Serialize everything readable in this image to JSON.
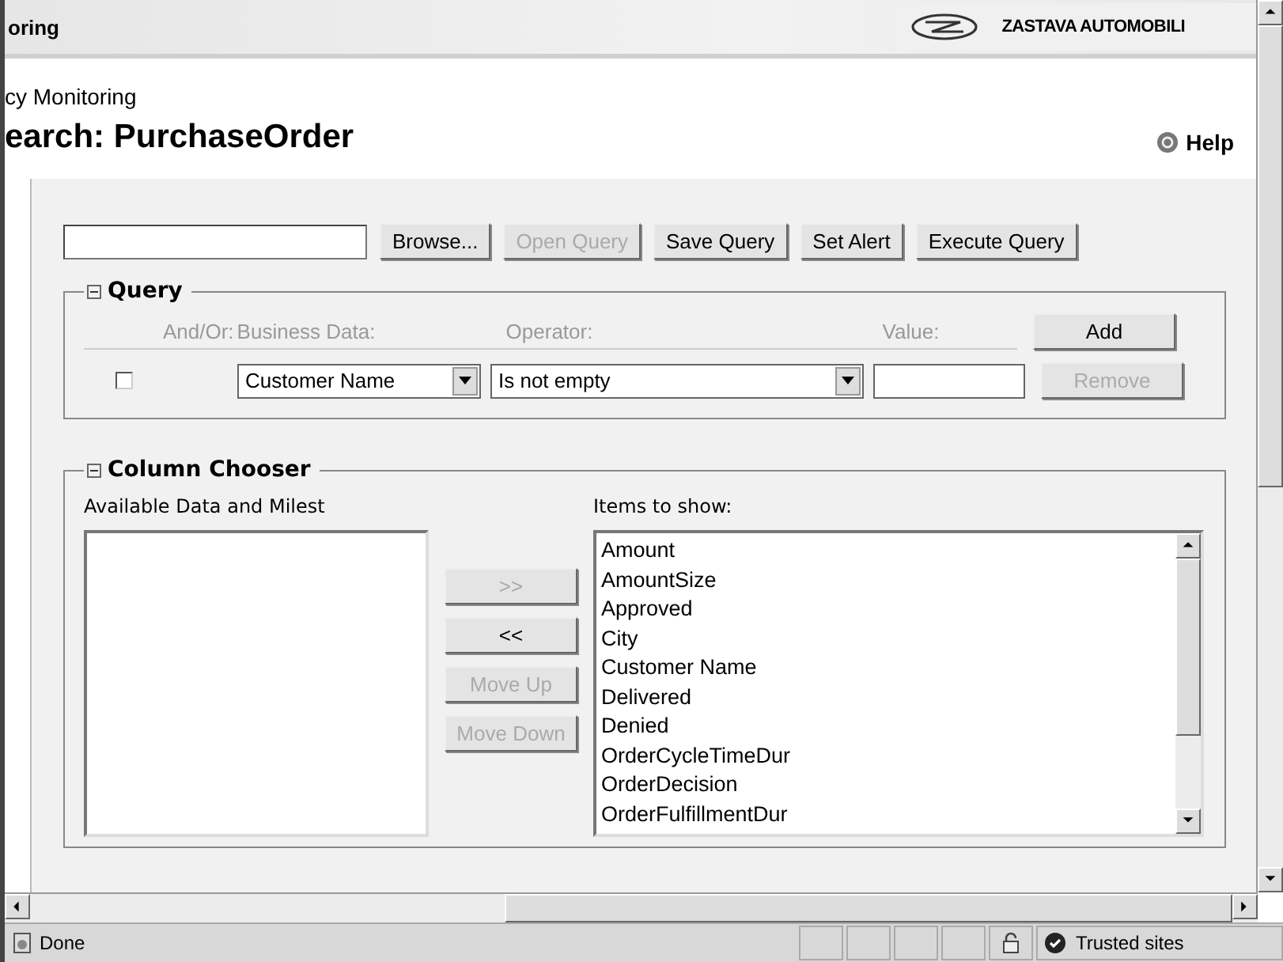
{
  "header": {
    "title": "oring",
    "brand": "ZASTAVA AUTOMOBILI"
  },
  "page": {
    "breadcrumb": "cy Monitoring",
    "title": "earch: PurchaseOrder",
    "help": "Help"
  },
  "toolbar": {
    "buttons": [
      {
        "label": "Browse...",
        "disabled": false
      },
      {
        "label": "Open Query",
        "disabled": true
      },
      {
        "label": "Save Query",
        "disabled": false
      },
      {
        "label": "Set Alert",
        "disabled": false
      },
      {
        "label": "Execute Query",
        "disabled": false
      }
    ]
  },
  "query": {
    "title": "Query",
    "expanded": true,
    "columns": [
      "And/Or:",
      "Business Data:",
      "Operator:",
      "Value:"
    ],
    "row": {
      "checked": false,
      "business_data": "Customer Name",
      "operator": "Is not empty"
    },
    "buttons": [
      {
        "label": "Add",
        "disabled": false
      },
      {
        "label": "Remove",
        "disabled": true
      }
    ]
  },
  "column_chooser": {
    "title": "Column Chooser",
    "expanded": true,
    "available_label": "Available Data and Milest",
    "items_label": "Items to show:",
    "buttons": [
      {
        "label": ">>",
        "disabled": true
      },
      {
        "label": "<<",
        "disabled": false
      },
      {
        "label": "Move Up",
        "disabled": true
      },
      {
        "label": "Move Down",
        "disabled": true
      }
    ],
    "items": [
      "Amount",
      "AmountSize",
      "Approved",
      "City",
      "Customer Name",
      "Delivered",
      "Denied",
      "OrderCycleTimeDur",
      "OrderDecision",
      "OrderFulfillmentDur"
    ]
  },
  "status_bar": {
    "text": "Done",
    "zone": "Trusted sites"
  }
}
